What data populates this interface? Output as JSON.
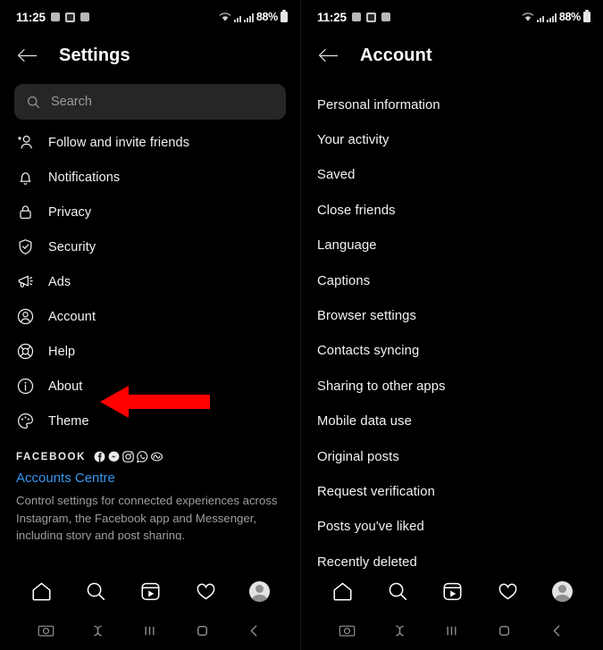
{
  "colors": {
    "background": "#000000",
    "accent_link": "#3897f0",
    "arrow": "#FF0000",
    "search_field": "#262626",
    "text_primary": "#f2f2f2",
    "text_secondary": "#9e9e9e"
  },
  "status_bar": {
    "time": "11:25",
    "battery": "88%",
    "icons": [
      "notification-icon",
      "multi-window-icon",
      "notification-icon"
    ],
    "right_icons": [
      "wifi-icon",
      "signal-alt-icon",
      "signal-icon",
      "battery-icon"
    ]
  },
  "left_panel": {
    "title": "Settings",
    "back_icon": "back-arrow-icon",
    "search": {
      "placeholder": "Search",
      "icon": "search-icon"
    },
    "items": [
      {
        "label": "Follow and invite friends",
        "icon": "person-add-icon"
      },
      {
        "label": "Notifications",
        "icon": "bell-icon"
      },
      {
        "label": "Privacy",
        "icon": "lock-icon"
      },
      {
        "label": "Security",
        "icon": "shield-check-icon"
      },
      {
        "label": "Ads",
        "icon": "megaphone-icon"
      },
      {
        "label": "Account",
        "icon": "user-circle-icon"
      },
      {
        "label": "Help",
        "icon": "lifebuoy-icon"
      },
      {
        "label": "About",
        "icon": "info-circle-icon"
      },
      {
        "label": "Theme",
        "icon": "palette-icon"
      }
    ],
    "facebook_section": {
      "heading": "FACEBOOK",
      "brand_icons": [
        "facebook-icon",
        "messenger-icon",
        "instagram-icon",
        "whatsapp-icon",
        "meta-icon"
      ],
      "link": "Accounts Centre",
      "description": "Control settings for connected experiences across Instagram, the Facebook app and Messenger, including story and post sharing."
    }
  },
  "right_panel": {
    "title": "Account",
    "back_icon": "back-arrow-icon",
    "items": [
      {
        "label": "Personal information"
      },
      {
        "label": "Your activity"
      },
      {
        "label": "Saved"
      },
      {
        "label": "Close friends"
      },
      {
        "label": "Language"
      },
      {
        "label": "Captions"
      },
      {
        "label": "Browser settings"
      },
      {
        "label": "Contacts syncing"
      },
      {
        "label": "Sharing to other apps"
      },
      {
        "label": "Mobile data use"
      },
      {
        "label": "Original posts"
      },
      {
        "label": "Request verification"
      },
      {
        "label": "Posts you've liked"
      },
      {
        "label": "Recently deleted"
      }
    ]
  },
  "bottom_nav": {
    "items": [
      "home-icon",
      "search-icon",
      "reels-icon",
      "heart-icon",
      "profile-avatar"
    ]
  },
  "system_nav": {
    "items": [
      "camera-icon",
      "bixby-icon",
      "recents-icon",
      "home-square-icon",
      "back-chevron-icon"
    ]
  },
  "annotations": [
    {
      "name": "arrow-pointing-to-account",
      "target": "Account"
    },
    {
      "name": "arrow-pointing-to-posts-youve-liked",
      "target": "Posts you've liked"
    }
  ]
}
